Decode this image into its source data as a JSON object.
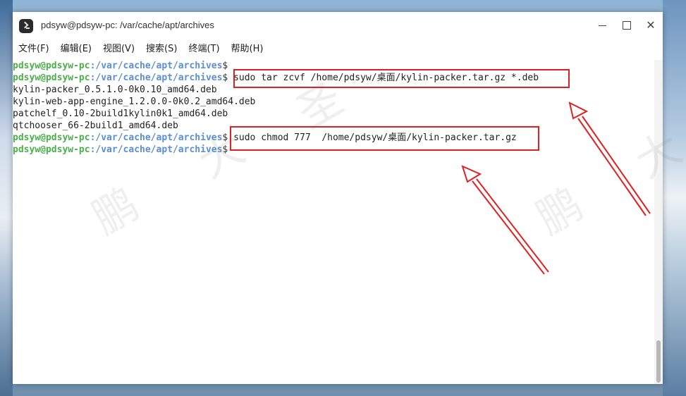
{
  "window": {
    "title": "pdsyw@pdsyw-pc: /var/cache/apt/archives",
    "controls": [
      "minimize-icon",
      "maximize-icon",
      "close-icon"
    ]
  },
  "menu": [
    {
      "label": "文件(F)"
    },
    {
      "label": "编辑(E)"
    },
    {
      "label": "视图(V)"
    },
    {
      "label": "搜索(S)"
    },
    {
      "label": "终端(T)"
    },
    {
      "label": "帮助(H)"
    }
  ],
  "terminal": {
    "prompt_user": "pdsyw@pdsyw-pc",
    "prompt_path": ":/var/cache/apt/archives",
    "prompt_dollar": "$",
    "lines": [
      {
        "type": "prompt",
        "cmd": ""
      },
      {
        "type": "prompt",
        "cmd": " sudo tar zcvf /home/pdsyw/桌面/kylin-packer.tar.gz *.deb"
      },
      {
        "type": "output",
        "text": "kylin-packer_0.5.1.0-0k0.10_amd64.deb"
      },
      {
        "type": "output",
        "text": "kylin-web-app-engine_1.2.0.0-0k0.2_amd64.deb"
      },
      {
        "type": "output",
        "text": "patchelf_0.10-2build1kylin0k1_amd64.deb"
      },
      {
        "type": "output",
        "text": "qtchooser_66-2build1_amd64.deb"
      },
      {
        "type": "prompt",
        "cmd": " sudo chmod 777  /home/pdsyw/桌面/kylin-packer.tar.gz"
      },
      {
        "type": "prompt",
        "cmd": ""
      }
    ]
  },
  "annotations": {
    "highlight_color": "#e02020",
    "watermark_chars": [
      "鹏",
      "大",
      "圣",
      "鹏",
      "大"
    ]
  }
}
